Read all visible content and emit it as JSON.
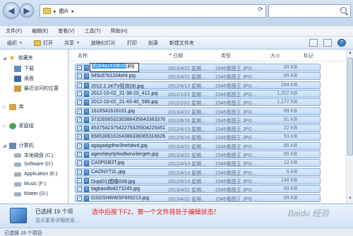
{
  "address": {
    "path": "图片"
  },
  "menu": [
    "文件(F)",
    "编辑(E)",
    "查看(V)",
    "工具(T)",
    "帮助(H)"
  ],
  "toolbar": {
    "organize": "组织",
    "open": "打开",
    "share": "共享",
    "slideshow": "放映幻灯片",
    "print": "打印",
    "email": "刻录",
    "new_folder": "新建文件夹"
  },
  "nav": {
    "favorites": "收藏夹",
    "downloads": "下载",
    "desktop": "桌面",
    "recent": "最近访问的位置",
    "libraries": "库",
    "homegroup": "家庭组",
    "computer": "计算机",
    "drives": [
      "本地磁盘 (C:)",
      "Software (D:)",
      "Application (E:)",
      "Music (F:)",
      "Matter (G:)"
    ]
  },
  "columns": {
    "name": "名称",
    "date": "日期",
    "type": "类型",
    "size": "大小",
    "tags": "标记"
  },
  "rename": {
    "selected": "3f1b4a1418b15",
    "rest": ".jpg"
  },
  "files": [
    {
      "name": "",
      "date": "2013/4/22 星期...",
      "type": "2345看图王 JPG ...",
      "size": "89 KB"
    },
    {
      "name": "945c87b1164ef4.jpg",
      "date": "2013/4/22 星期...",
      "type": "2345看图王 JPG ...",
      "size": "85 KB"
    },
    {
      "name": "2012.2.1KTV狂欢(8).jpg",
      "date": "2012/4/13 星期...",
      "type": "2345看图王 JPG ...",
      "size": "184 KB"
    },
    {
      "name": "2012-10-02_21-38-20_412.jpg",
      "date": "2012/10/2 星期...",
      "type": "2345看图王 JPG ...",
      "size": "1,207 KB"
    },
    {
      "name": "2012-10-02_21-43-40_586.jpg",
      "date": "2012/10/2 星期...",
      "type": "2345看图王 JPG ...",
      "size": "1,177 KB"
    },
    {
      "name": "1616541616161.jpg",
      "date": "2013/4/22 星期...",
      "type": "2345看图王 JPG ...",
      "size": "89 KB"
    },
    {
      "name": "373265653230386435643363376...",
      "date": "2012/9/16 星期...",
      "type": "2345看图王 JPG ...",
      "size": "91 KB"
    },
    {
      "name": "453754237542275325504225451...",
      "date": "2012/4/13 星期...",
      "type": "2345看图王 JPG ...",
      "size": "22 KB"
    },
    {
      "name": "656530616164386336065316626...",
      "date": "2012/9/16 星期...",
      "type": "2345看图王 JPG ...",
      "size": "93 KB"
    },
    {
      "name": "agagadgdhw3hehdwd.jpg",
      "date": "2013/4/22 星期...",
      "type": "2345看图王 JPG ...",
      "size": "85 KB"
    },
    {
      "name": "agenhteyrtjrfwdfwrw3ergeh.jpg",
      "date": "2013/4/22 星期...",
      "type": "2345看图王 JPG ...",
      "size": "85 KB"
    },
    {
      "name": "CA5PGB3T.jpg",
      "date": "2012/4/13 星期...",
      "type": "2345看图王 JPG ...",
      "size": "12 KB"
    },
    {
      "name": "CAONYT2L.jpg",
      "date": "2012/4/13 星期...",
      "type": "2345看图王 JPG ...",
      "size": "5 KB"
    },
    {
      "name": "Dup(01)图像039.jpg",
      "date": "2012/4/13 星期...",
      "type": "2345看图王 JPG ...",
      "size": "146 KB"
    },
    {
      "name": "fagbasdfd4273245.jpg",
      "date": "2013/4/22 星期...",
      "type": "2345看图王 JPG ...",
      "size": "89 KB"
    },
    {
      "name": "GSGSHWWSF656213.jpg",
      "date": "2013/4/22 星期...",
      "type": "2345看图王 JPG ...",
      "size": "89 KB"
    }
  ],
  "details": {
    "count": "已选择 19 个项",
    "link": "显示更多详细信息..."
  },
  "caption": "选中后按下F2，第一个文件将处于编辑状态！",
  "status": "已选择 19 个项目",
  "watermark": "Baidu 经验"
}
